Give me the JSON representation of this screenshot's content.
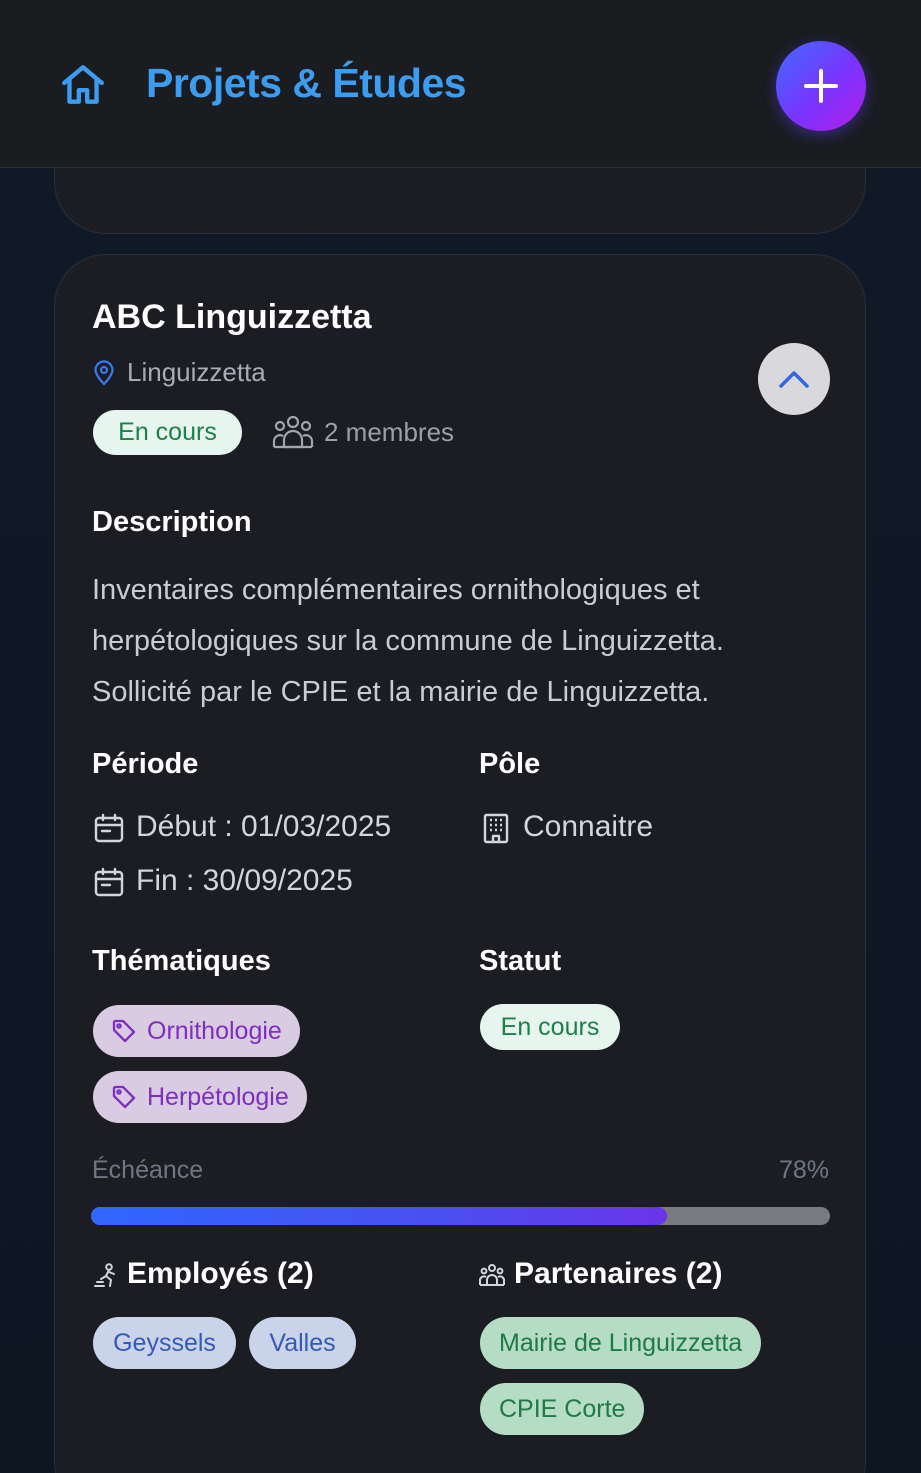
{
  "header": {
    "title": "Projets & Études",
    "home_icon": "home-icon",
    "add_icon": "plus-icon",
    "accent_color": "#3b9cf0"
  },
  "project": {
    "name": "ABC Linguizzetta",
    "location": "Linguizzetta",
    "status_badge": "En cours",
    "members": "2 membres",
    "description_label": "Description",
    "description": "Inventaires complémentaires ornithologiques et herpétologiques sur la commune de Linguizzetta. Sollicité par le CPIE et la mairie de Linguizzetta.",
    "periode_label": "Période",
    "start": "Début : 01/03/2025",
    "end": "Fin : 30/09/2025",
    "pole_label": "Pôle",
    "pole": "Connaitre",
    "thematiques_label": "Thématiques",
    "thematiques": [
      "Ornithologie",
      "Herpétologie"
    ],
    "statut_label": "Statut",
    "statut": "En cours",
    "echeance_label": "Échéance",
    "echeance_pct": "78%",
    "progress": 0.78,
    "employes_label": "Employés (2)",
    "employes": [
      "Geyssels",
      "Valles"
    ],
    "partenaires_label": "Partenaires (2)",
    "partenaires": [
      "Mairie de Linguizzetta",
      "CPIE Corte"
    ]
  }
}
